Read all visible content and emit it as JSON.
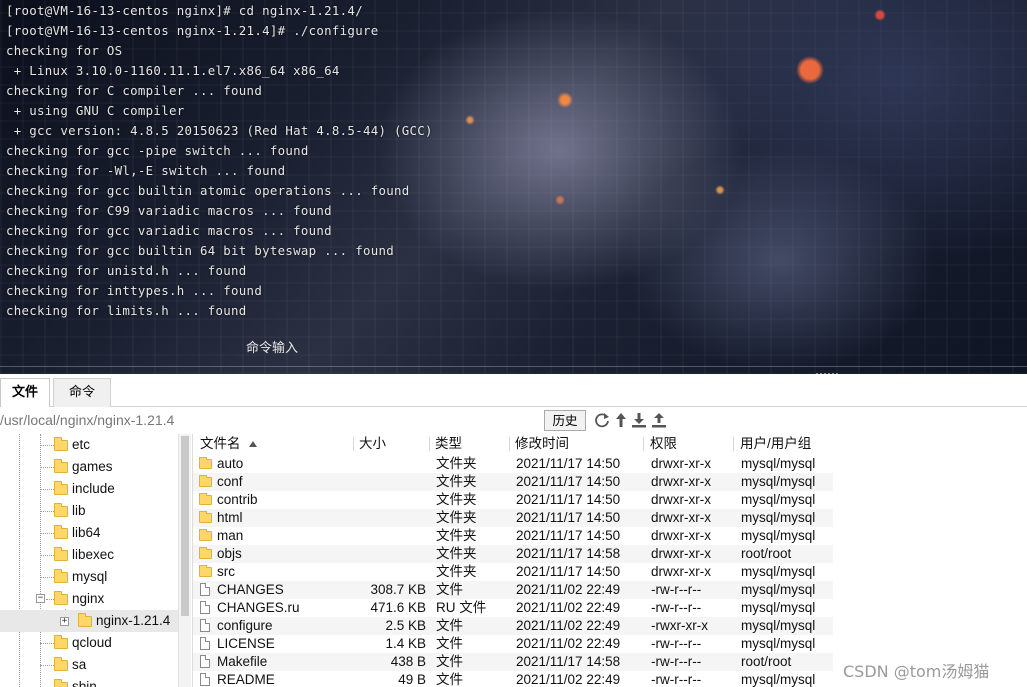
{
  "terminal": {
    "lines": [
      "[root@VM-16-13-centos nginx]# cd nginx-1.21.4/",
      "[root@VM-16-13-centos nginx-1.21.4]# ./configure",
      "checking for OS",
      " + Linux 3.10.0-1160.11.1.el7.x86_64 x86_64",
      "checking for C compiler ... found",
      " + using GNU C compiler",
      " + gcc version: 4.8.5 20150623 (Red Hat 4.8.5-44) (GCC)",
      "checking for gcc -pipe switch ... found",
      "checking for -Wl,-E switch ... found",
      "checking for gcc builtin atomic operations ... found",
      "checking for C99 variadic macros ... found",
      "checking for gcc variadic macros ... found",
      "checking for gcc builtin 64 bit byteswap ... found",
      "checking for unistd.h ... found",
      "checking for inttypes.h ... found",
      "checking for limits.h ... found"
    ],
    "command_input_label": "命令输入"
  },
  "tabs": [
    {
      "label": "文件",
      "active": true
    },
    {
      "label": "命令",
      "active": false
    }
  ],
  "pathbar": {
    "path": "/usr/local/nginx/nginx-1.21.4",
    "history_label": "历史",
    "icons": [
      "refresh-icon",
      "up-arrow-icon",
      "download-icon",
      "upload-icon"
    ]
  },
  "tree": {
    "items": [
      {
        "label": "etc"
      },
      {
        "label": "games"
      },
      {
        "label": "include"
      },
      {
        "label": "lib"
      },
      {
        "label": "lib64"
      },
      {
        "label": "libexec"
      },
      {
        "label": "mysql"
      },
      {
        "label": "nginx",
        "expanded": true
      },
      {
        "label": "nginx-1.21.4",
        "selected": true
      },
      {
        "label": "qcloud"
      },
      {
        "label": "sa"
      },
      {
        "label": "sbin"
      }
    ]
  },
  "filelist": {
    "columns": [
      "文件名",
      "大小",
      "类型",
      "修改时间",
      "权限",
      "用户/用户组"
    ],
    "rows": [
      {
        "name": "auto",
        "size": "",
        "type": "文件夹",
        "mtime": "2021/11/17 14:50",
        "perm": "drwxr-xr-x",
        "owner": "mysql/mysql",
        "kind": "folder"
      },
      {
        "name": "conf",
        "size": "",
        "type": "文件夹",
        "mtime": "2021/11/17 14:50",
        "perm": "drwxr-xr-x",
        "owner": "mysql/mysql",
        "kind": "folder"
      },
      {
        "name": "contrib",
        "size": "",
        "type": "文件夹",
        "mtime": "2021/11/17 14:50",
        "perm": "drwxr-xr-x",
        "owner": "mysql/mysql",
        "kind": "folder"
      },
      {
        "name": "html",
        "size": "",
        "type": "文件夹",
        "mtime": "2021/11/17 14:50",
        "perm": "drwxr-xr-x",
        "owner": "mysql/mysql",
        "kind": "folder"
      },
      {
        "name": "man",
        "size": "",
        "type": "文件夹",
        "mtime": "2021/11/17 14:50",
        "perm": "drwxr-xr-x",
        "owner": "mysql/mysql",
        "kind": "folder"
      },
      {
        "name": "objs",
        "size": "",
        "type": "文件夹",
        "mtime": "2021/11/17 14:58",
        "perm": "drwxr-xr-x",
        "owner": "root/root",
        "kind": "folder"
      },
      {
        "name": "src",
        "size": "",
        "type": "文件夹",
        "mtime": "2021/11/17 14:50",
        "perm": "drwxr-xr-x",
        "owner": "mysql/mysql",
        "kind": "folder"
      },
      {
        "name": "CHANGES",
        "size": "308.7 KB",
        "type": "文件",
        "mtime": "2021/11/02 22:49",
        "perm": "-rw-r--r--",
        "owner": "mysql/mysql",
        "kind": "file"
      },
      {
        "name": "CHANGES.ru",
        "size": "471.6 KB",
        "type": "RU 文件",
        "mtime": "2021/11/02 22:49",
        "perm": "-rw-r--r--",
        "owner": "mysql/mysql",
        "kind": "file"
      },
      {
        "name": "configure",
        "size": "2.5 KB",
        "type": "文件",
        "mtime": "2021/11/02 22:49",
        "perm": "-rwxr-xr-x",
        "owner": "mysql/mysql",
        "kind": "file"
      },
      {
        "name": "LICENSE",
        "size": "1.4 KB",
        "type": "文件",
        "mtime": "2021/11/02 22:49",
        "perm": "-rw-r--r--",
        "owner": "mysql/mysql",
        "kind": "file"
      },
      {
        "name": "Makefile",
        "size": "438 B",
        "type": "文件",
        "mtime": "2021/11/17 14:58",
        "perm": "-rw-r--r--",
        "owner": "root/root",
        "kind": "file"
      },
      {
        "name": "README",
        "size": "49 B",
        "type": "文件",
        "mtime": "2021/11/02 22:49",
        "perm": "-rw-r--r--",
        "owner": "mysql/mysql",
        "kind": "file"
      }
    ]
  },
  "watermark": "CSDN @tom汤姆猫"
}
